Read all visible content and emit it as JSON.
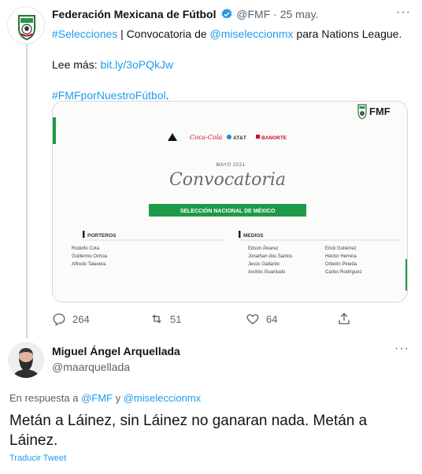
{
  "tweet": {
    "author_name": "Federación Mexicana de Fútbol",
    "handle": "@FMF",
    "separator": "·",
    "date": "25 may.",
    "more": "···",
    "line1": {
      "hashtag": "#Selecciones",
      "text_a": " | Convocatoria de ",
      "mention": "@miseleccionmx",
      "text_b": " para Nations League."
    },
    "line2": {
      "label": "Lee más: ",
      "link": "bit.ly/3oPQkJw"
    },
    "line3": {
      "hashtag": "#FMFporNuestroFútbol",
      "suffix": "."
    },
    "image": {
      "brand": "FMF",
      "sponsors": [
        "adidas",
        "Coca-Cola",
        "AT&T",
        "BANORTE"
      ],
      "date_label": "MAYO 2021",
      "script_title": "Convocatoria",
      "banner": "SELECCIÓN NACIONAL DE MÉXICO",
      "sections": [
        {
          "title": "PORTEROS",
          "col1": [
            "Rodolfo Cota",
            "Guillermo Ochoa",
            "Alfredo Talavera"
          ],
          "col2": []
        },
        {
          "title": "MEDIOS",
          "col1": [
            "Edson Álvarez",
            "Jonathan dos Santos",
            "Jesús Gallardo",
            "Andrés Guardado"
          ],
          "col2": [
            "Erick Gutiérrez",
            "Héctor Herrera",
            "Orbelín Pineda",
            "Carlos Rodríguez"
          ]
        }
      ]
    },
    "actions": {
      "replies": "264",
      "retweets": "51",
      "likes": "64"
    }
  },
  "reply": {
    "author_name": "Miguel Ángel Arquellada",
    "handle": "@maarquellada",
    "more": "···",
    "replying_prefix": "En respuesta a ",
    "replying_to_1": "@FMF",
    "replying_and": " y ",
    "replying_to_2": "@miseleccionmx",
    "text": "Metán a Láinez, sin Láinez no ganaran nada. Metán a Láinez.",
    "translate": "Traducir Tweet"
  },
  "colors": {
    "link": "#1d9bf0",
    "muted": "#536471",
    "green": "#1e9a46",
    "red": "#c8102e"
  }
}
